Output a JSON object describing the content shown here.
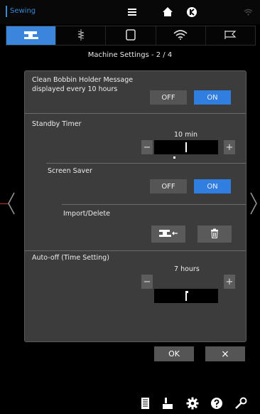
{
  "app": {
    "title": "Sewing"
  },
  "page": {
    "title": "Machine Settings - 2 / 4"
  },
  "settings": {
    "bobbin": {
      "label_line1": "Clean Bobbin Holder Message",
      "label_line2": "displayed every 10 hours",
      "off": "OFF",
      "on": "ON",
      "selected": "ON"
    },
    "standby": {
      "label": "Standby Timer",
      "value": "10 min"
    },
    "screen_saver": {
      "label": "Screen Saver",
      "off": "OFF",
      "on": "ON",
      "selected": "ON"
    },
    "import_delete": {
      "label": "Import/Delete"
    },
    "auto_off": {
      "label": "Auto-off (Time Setting)",
      "value": "7 hours"
    }
  },
  "buttons": {
    "ok": "OK",
    "cancel": "×",
    "minus": "−",
    "plus": "+"
  },
  "colors": {
    "accent": "#2f7ee0",
    "panel": "#3c3c3c",
    "toggle_off": "#555555"
  },
  "icons": {
    "top": [
      "menu-icon",
      "home-icon",
      "back-icon",
      "wifi-icon"
    ],
    "tabs": [
      "sewing-machine-icon",
      "bobbin-icon",
      "frame-icon",
      "wifi-icon",
      "flag-icon"
    ],
    "bottom": [
      "manual-icon",
      "needle-icon",
      "settings-gear-icon",
      "help-icon",
      "wrench-icon"
    ]
  }
}
